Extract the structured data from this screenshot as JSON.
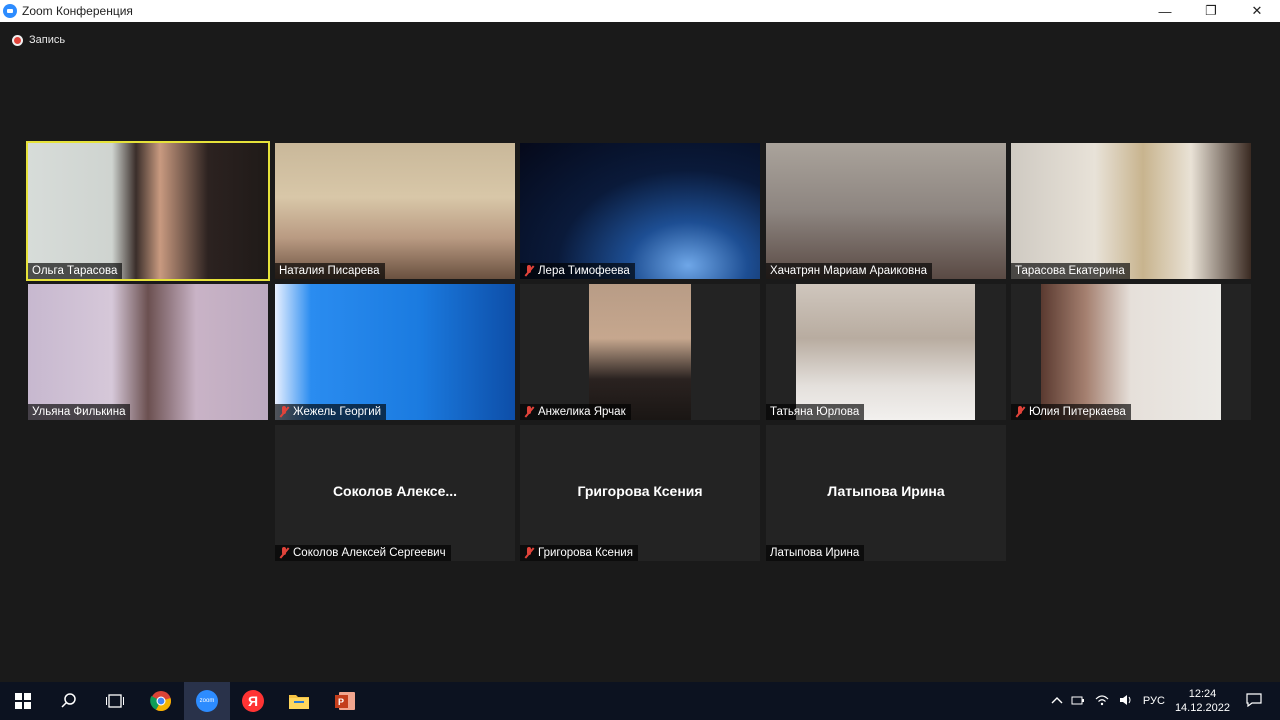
{
  "window": {
    "title": "Zoom Конференция",
    "minimize": "—",
    "maximize": "❐",
    "close": "✕"
  },
  "recording": {
    "label": "Запись"
  },
  "participants": [
    {
      "name": "Ольга Тарасова",
      "muted": false
    },
    {
      "name": "Наталия Писарева",
      "muted": false
    },
    {
      "name": "Лера Тимофеева",
      "muted": true
    },
    {
      "name": "Хачатрян Мариам Араиковна",
      "muted": false
    },
    {
      "name": "Тарасова Екатерина",
      "muted": false
    },
    {
      "name": "Ульяна Филькина",
      "muted": false
    },
    {
      "name": "Жежель Георгий",
      "muted": true
    },
    {
      "name": "Анжелика Ярчак",
      "muted": true
    },
    {
      "name": "Татьяна Юрлова",
      "muted": false
    },
    {
      "name": "Юлия Питеркаева",
      "muted": true
    },
    {
      "name": "Соколов Алексей Сергеевич",
      "display": "Соколов  Алексе...",
      "muted": true
    },
    {
      "name": "Григорова Ксения",
      "display": "Григорова Ксения",
      "muted": true
    },
    {
      "name": "Латыпова Ирина",
      "display": "Латыпова Ирина",
      "muted": false
    }
  ],
  "taskbar": {
    "apps": [
      "windows-start",
      "search",
      "task-view",
      "chrome",
      "zoom",
      "yandex",
      "file-explorer",
      "powerpoint"
    ],
    "zoom_label": "zoom",
    "yandex_label": "Я",
    "tray": {
      "language": "РУС",
      "time": "12:24",
      "date": "14.12.2022"
    }
  },
  "colors": {
    "active_speaker": "#e6e23a",
    "muted_mic": "#e0433a",
    "zoom_blue": "#2d8cff"
  }
}
